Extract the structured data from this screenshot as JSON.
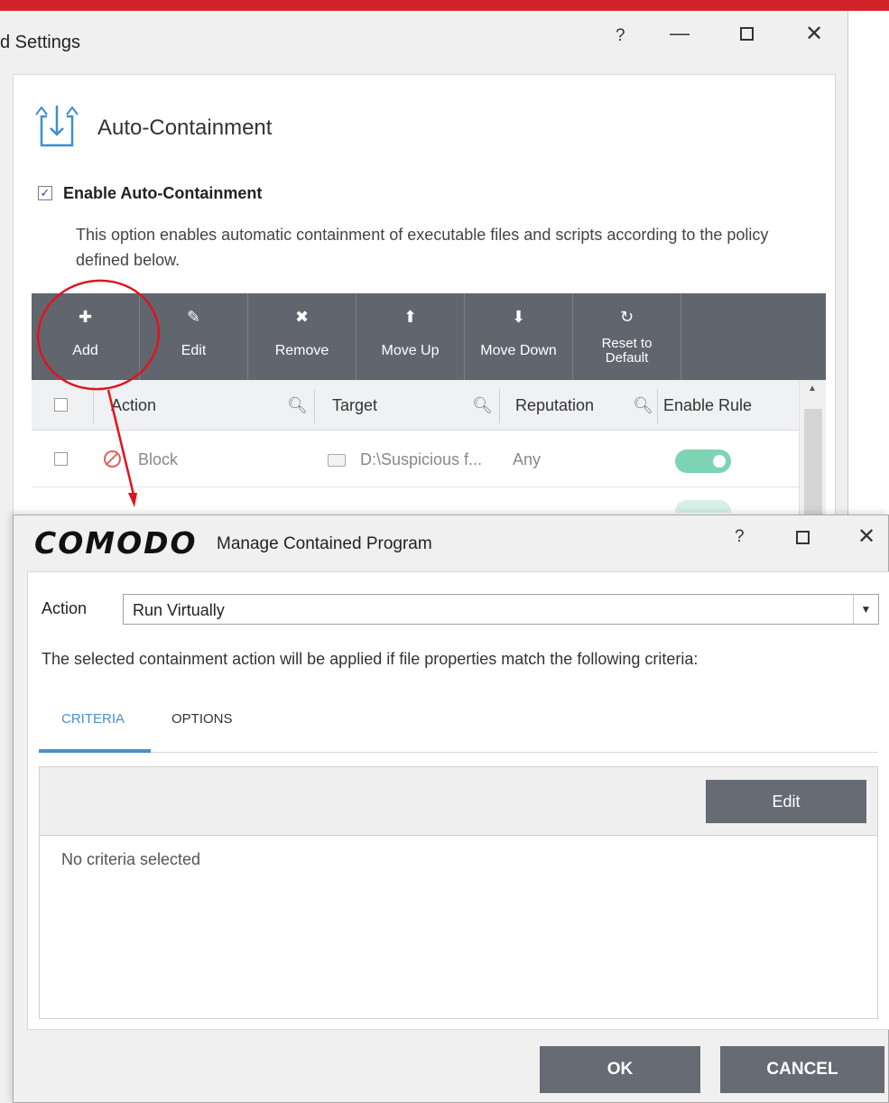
{
  "background_window": {
    "title": "d Settings",
    "controls": {
      "help": "?",
      "minimize": "—",
      "close": "✕"
    },
    "section_title": "Auto-Containment",
    "enable_label": "Enable Auto-Containment",
    "enable_checked": true,
    "description": "This option enables automatic containment of executable files and scripts according to the policy defined below.",
    "toolbar": [
      {
        "icon": "plus-icon",
        "glyph": "✚",
        "label": "Add"
      },
      {
        "icon": "pencil-icon",
        "glyph": "✎",
        "label": "Edit"
      },
      {
        "icon": "x-icon",
        "glyph": "✖",
        "label": "Remove"
      },
      {
        "icon": "arrow-up-icon",
        "glyph": "⬆",
        "label": "Move Up"
      },
      {
        "icon": "arrow-down-icon",
        "glyph": "⬇",
        "label": "Move Down"
      },
      {
        "icon": "reset-icon",
        "glyph": "↻",
        "label_line1": "Reset to",
        "label_line2": "Default"
      }
    ],
    "columns": [
      "Action",
      "Target",
      "Reputation",
      "Enable Rule"
    ],
    "rows": [
      {
        "action": "Block",
        "target": "D:\\Suspicious f...",
        "reputation": "Any",
        "enabled": true
      }
    ]
  },
  "dialog": {
    "logo": "COMODO",
    "title": "Manage Contained Program",
    "controls": {
      "help": "?",
      "close": "✕"
    },
    "action_label": "Action",
    "action_value": "Run Virtually",
    "criteria_description": "The selected containment action will be applied if file properties match the following criteria:",
    "tabs": [
      "CRITERIA",
      "OPTIONS"
    ],
    "active_tab": "CRITERIA",
    "edit_label": "Edit",
    "empty_text": "No criteria selected",
    "ok_label": "OK",
    "cancel_label": "CANCEL"
  },
  "colors": {
    "accent_red": "#d2232a",
    "toolbar_gray": "#60656e",
    "tab_blue": "#4a90c8",
    "toggle_green": "#7dd4b4",
    "annotation_red": "#e0141e"
  }
}
